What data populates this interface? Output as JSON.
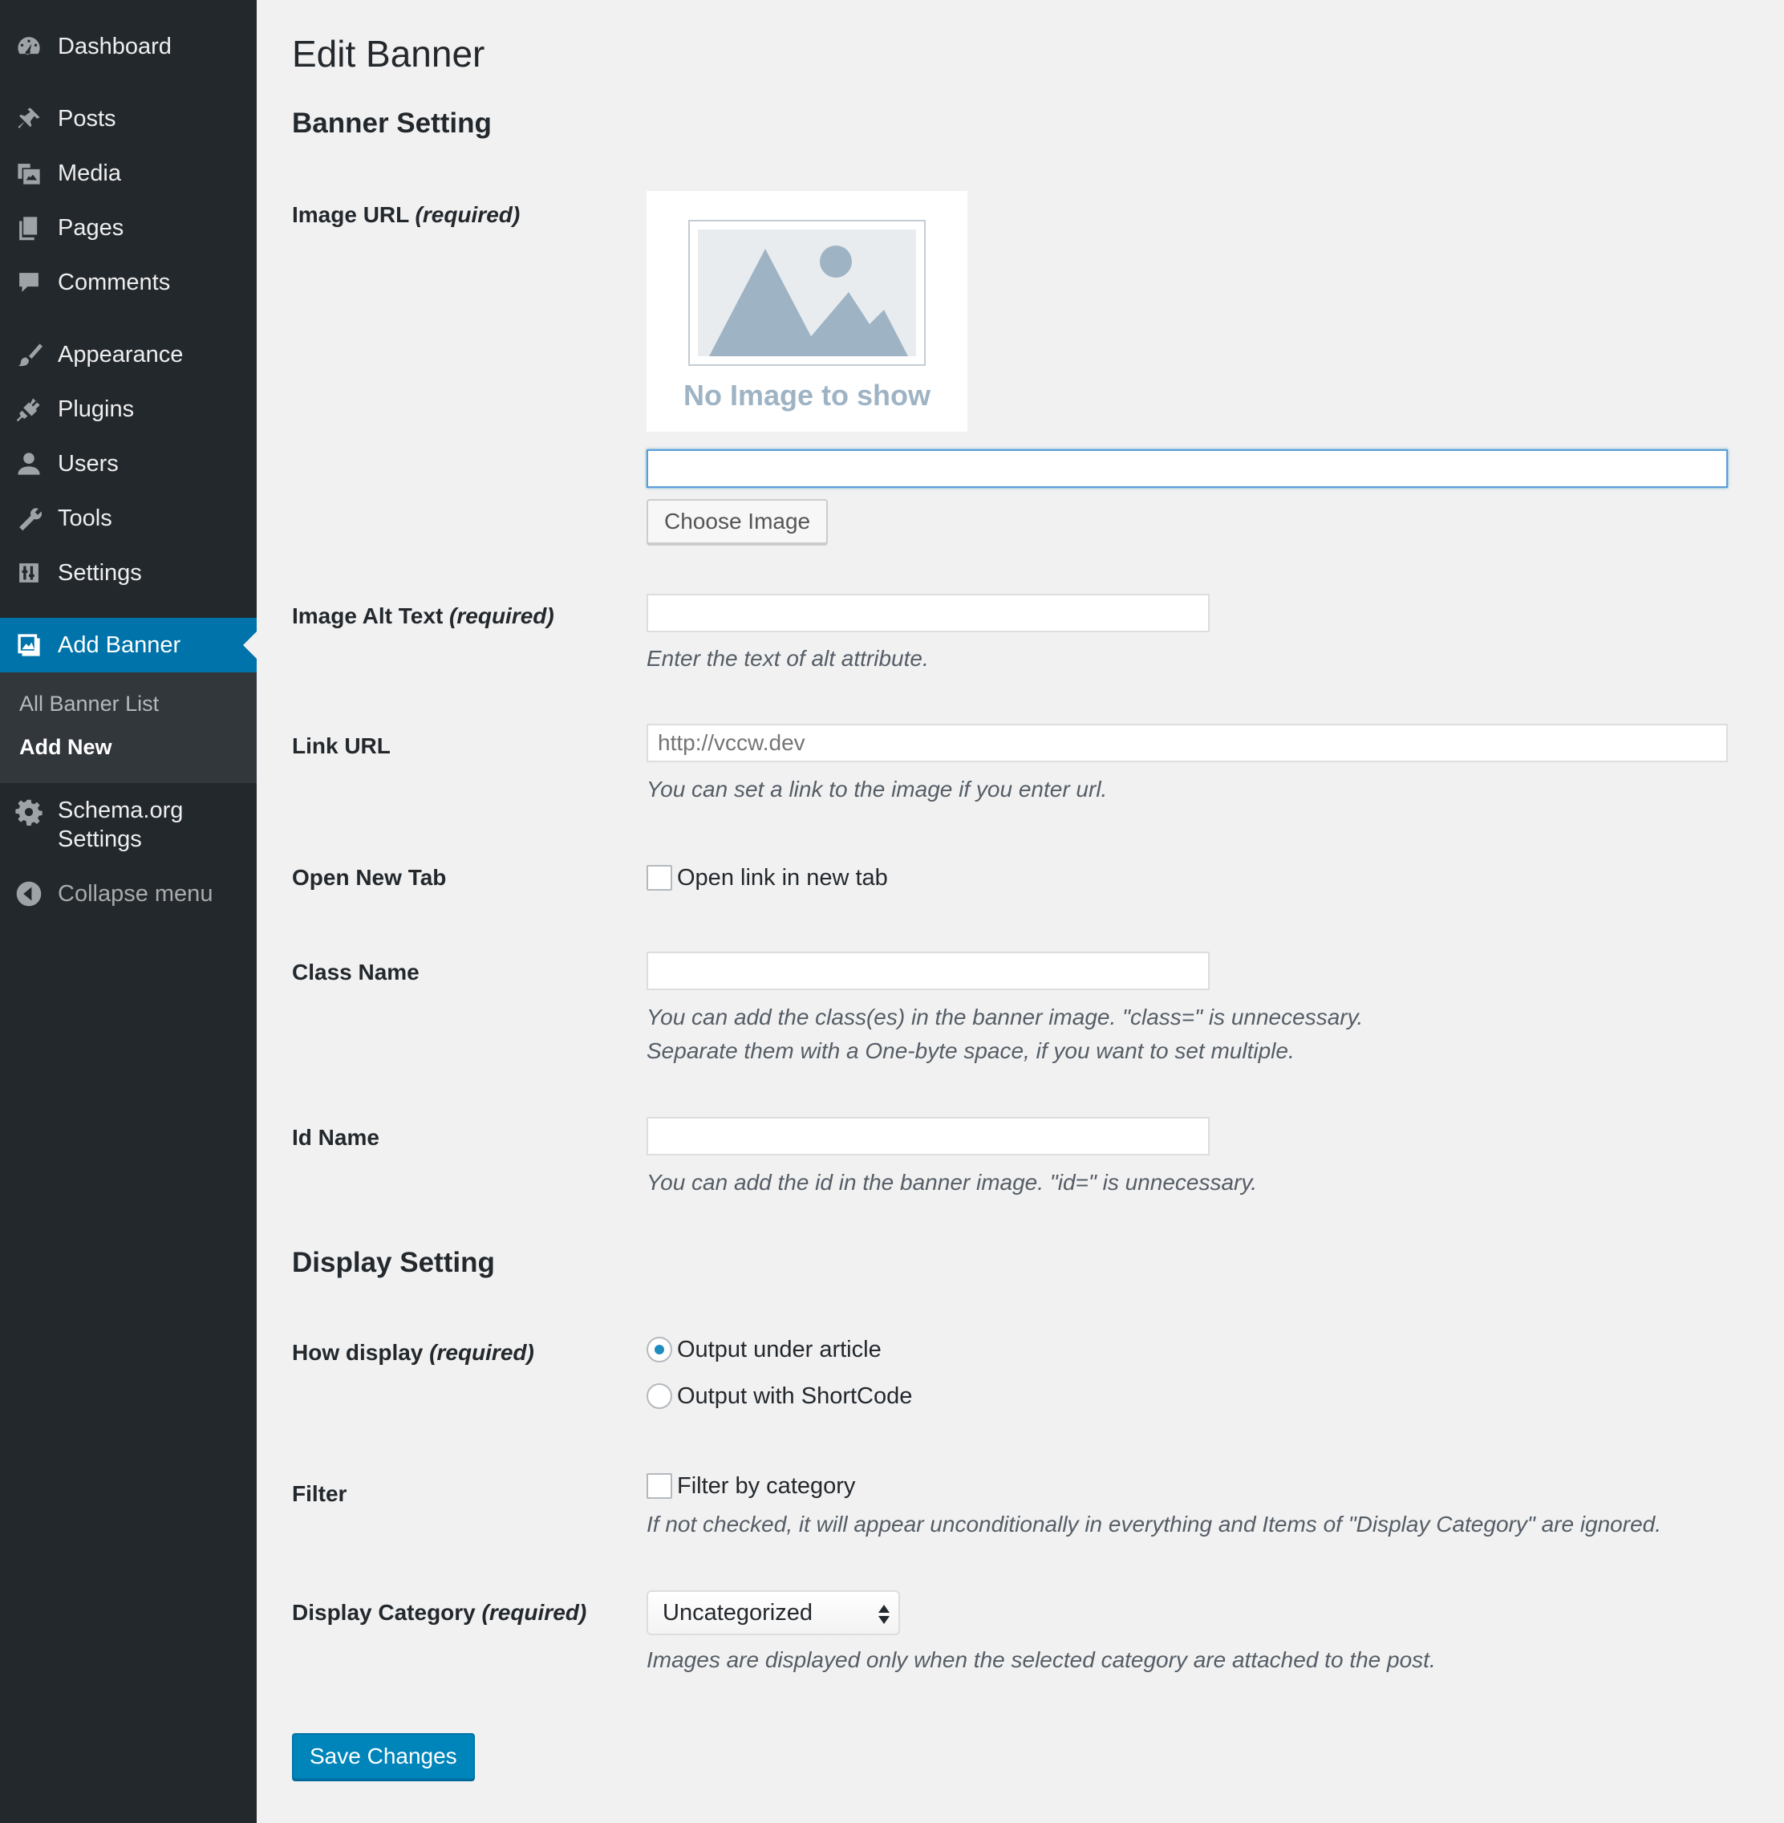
{
  "sidebar": {
    "items": [
      {
        "label": "Dashboard",
        "icon": "dashboard-icon"
      },
      {
        "label": "Posts",
        "icon": "pin-icon"
      },
      {
        "label": "Media",
        "icon": "media-icon"
      },
      {
        "label": "Pages",
        "icon": "pages-icon"
      },
      {
        "label": "Comments",
        "icon": "comment-icon"
      },
      {
        "label": "Appearance",
        "icon": "brush-icon"
      },
      {
        "label": "Plugins",
        "icon": "plug-icon"
      },
      {
        "label": "Users",
        "icon": "user-icon"
      },
      {
        "label": "Tools",
        "icon": "wrench-icon"
      },
      {
        "label": "Settings",
        "icon": "sliders-icon"
      },
      {
        "label": "Add Banner",
        "icon": "images-icon",
        "current": true
      },
      {
        "label": "Schema.org",
        "label2": "Settings",
        "icon": "gear-icon"
      },
      {
        "label": "Collapse menu",
        "icon": "collapse-icon"
      }
    ],
    "submenu": [
      {
        "label": "All Banner List"
      },
      {
        "label": "Add New",
        "active": true
      }
    ]
  },
  "page": {
    "title": "Edit Banner"
  },
  "banner_setting": {
    "heading": "Banner Setting",
    "image_url": {
      "label": "Image URL",
      "required": "(required)",
      "placeholder_text": "No Image to show",
      "value": "",
      "button": "Choose Image"
    },
    "alt_text": {
      "label": "Image Alt Text",
      "required": "(required)",
      "value": "",
      "description": "Enter the text of alt attribute."
    },
    "link_url": {
      "label": "Link URL",
      "placeholder": "http://vccw.dev",
      "description": "You can set a link to the image if you enter url."
    },
    "new_tab": {
      "label": "Open New Tab",
      "checkbox_label": "Open link in new tab",
      "checked": false
    },
    "class_name": {
      "label": "Class Name",
      "value": "",
      "description_1": "You can add the class(es) in the banner image. \"class=\" is unnecessary.",
      "description_2": "Separate them with a One-byte space, if you want to set multiple."
    },
    "id_name": {
      "label": "Id Name",
      "value": "",
      "description": "You can add the id in the banner image. \"id=\" is unnecessary."
    }
  },
  "display_setting": {
    "heading": "Display Setting",
    "how_display": {
      "label": "How display",
      "required": "(required)",
      "options": [
        "Output under article",
        "Output with ShortCode"
      ],
      "selected": "Output under article"
    },
    "filter": {
      "label": "Filter",
      "checkbox_label": "Filter by category",
      "checked": false,
      "description": "If not checked, it will appear unconditionally in everything and Items of \"Display Category\" are ignored."
    },
    "display_category": {
      "label": "Display Category",
      "required": "(required)",
      "selected": "Uncategorized",
      "description": "Images are displayed only when the selected category are attached to the post."
    }
  },
  "save_button": "Save Changes",
  "colors": {
    "sidebar_bg": "#23282d",
    "submenu_bg": "#32373c",
    "accent": "#0073aa",
    "primary_button": "#0085ba",
    "page_bg": "#f1f1f1"
  }
}
